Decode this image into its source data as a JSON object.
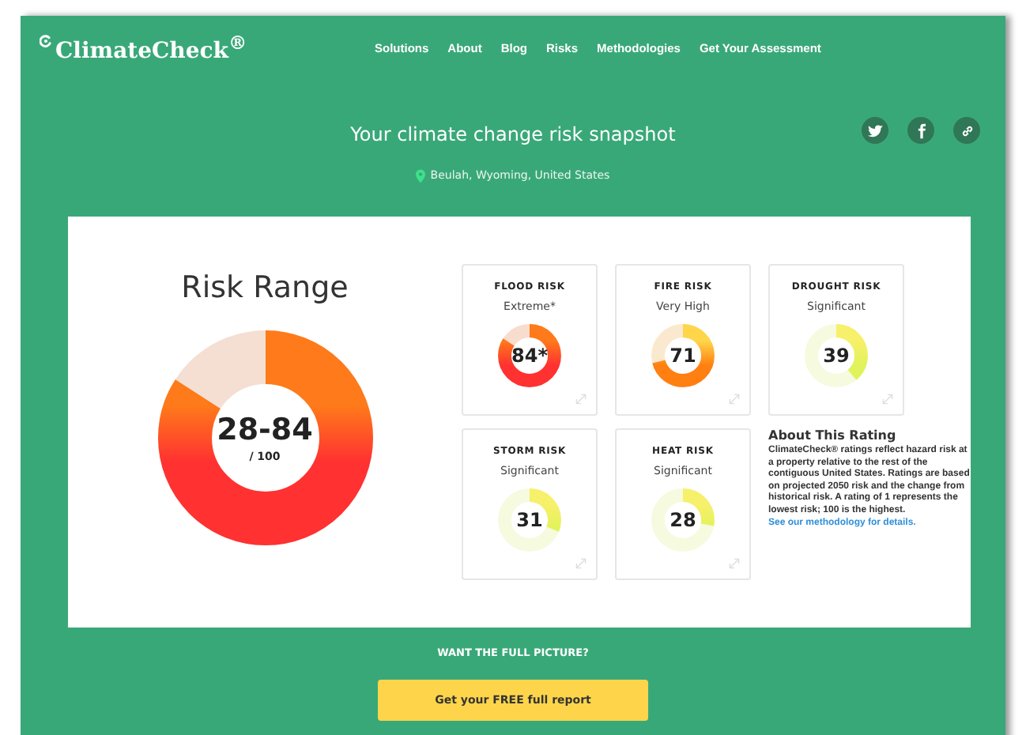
{
  "header": {
    "logo": "ClimateCheck$^{®}$",
    "nav": [
      "Solutions",
      "About",
      "Blog",
      "Risks",
      "Methodologies",
      "Get Your Assessment"
    ]
  },
  "hero": {
    "title": "Your climate change risk snapshot",
    "location": "Beulah, Wyoming, United States",
    "share": [
      {
        "kind": "twitter"
      },
      {
        "kind": "facebook"
      },
      {
        "kind": "link"
      }
    ]
  },
  "summary": {
    "title": "Risk Range",
    "score": "28-84",
    "scale": "/ 100"
  },
  "risks": [
    {
      "name": "FLOOD RISK",
      "rating": "Extreme*",
      "score": "84*"
    },
    {
      "name": "FIRE RISK",
      "rating": "Very High",
      "score": "71"
    },
    {
      "name": "DROUGHT RISK",
      "rating": "Significant",
      "score": "39"
    },
    {
      "name": "STORM RISK",
      "rating": "Significant",
      "score": "31"
    },
    {
      "name": "HEAT RISK",
      "rating": "Significant",
      "score": "28"
    }
  ],
  "about": {
    "title": "About This Rating",
    "text": "ClimateCheck® ratings reflect hazard risk at a property relative to the rest of the contiguous United States. Ratings are based on projected 2050 risk and the change from historical risk. A rating of 1 represents the lowest risk; 100 is the highest.",
    "link": "See our methodology for details."
  },
  "cta": {
    "prompt": "WANT THE FULL PICTURE?",
    "button": "Get your FREE full report"
  }
}
